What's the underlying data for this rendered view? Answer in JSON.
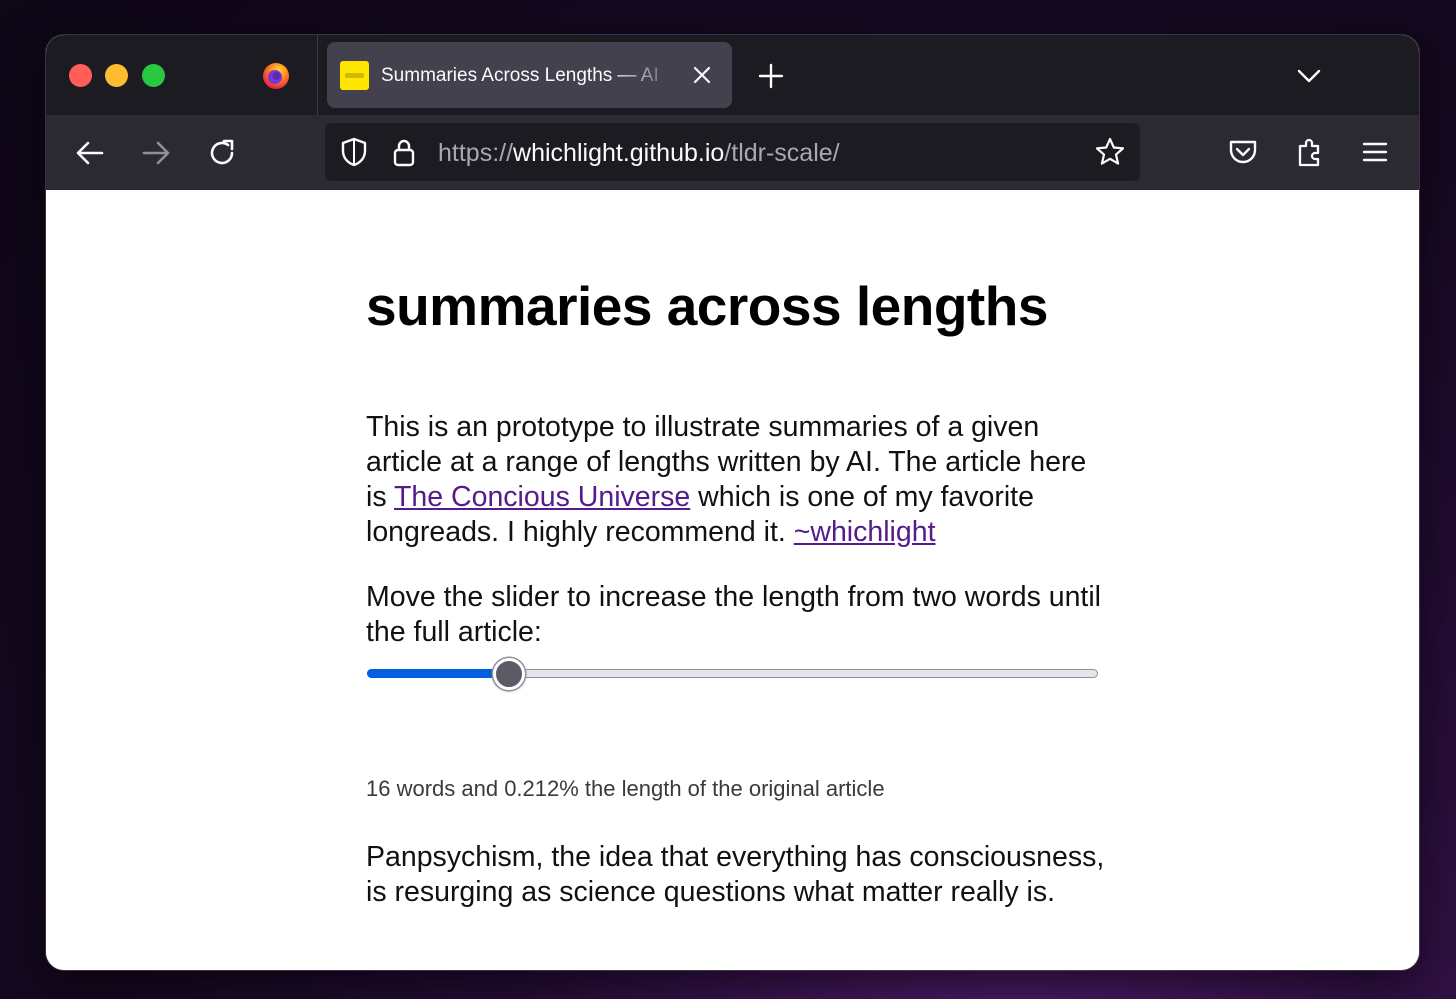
{
  "browser": {
    "tab": {
      "title": "Summaries Across Lengths — AI",
      "favicon": "yellow-square-favicon"
    },
    "url": {
      "scheme": "https://",
      "host": "whichlight.github.io",
      "path": "/tldr-scale/"
    },
    "icons": [
      "firefox-icon",
      "close-icon",
      "plus-icon",
      "chevron-down-icon",
      "back-arrow-icon",
      "forward-arrow-icon",
      "reload-icon",
      "shield-icon",
      "lock-icon",
      "star-icon",
      "pocket-icon",
      "extensions-icon",
      "hamburger-menu-icon"
    ]
  },
  "page": {
    "title": "summaries across lengths",
    "intro": {
      "before_link": "This is an prototype to illustrate summaries of a given article at a range of lengths written by AI. The article here is ",
      "link_text": "The Concious Universe",
      "after_link": " which is one of my favorite longreads. I highly recommend it. ",
      "author_link": "~whichlight"
    },
    "instructions": "Move the slider to increase the length from two words until the full article:",
    "slider": {
      "value_fraction": 0.195
    },
    "status": "16 words and 0.212% the length of the original article",
    "summary": "Panpsychism, the idea that everything has consciousness, is resurging as science questions what matter really is."
  },
  "colors": {
    "tabbar": "#1c1b22",
    "toolbar": "#2b2a33",
    "active_tab": "#42414d",
    "slider_fill": "#0060df",
    "link": "#551a8b"
  }
}
